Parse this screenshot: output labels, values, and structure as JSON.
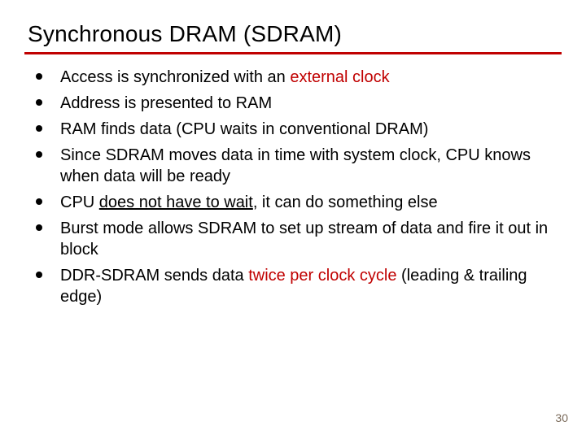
{
  "title": "Synchronous DRAM (SDRAM)",
  "bullets": [
    {
      "pre": "Access is synchronized with an ",
      "hl": "external clock",
      "post": ""
    },
    {
      "pre": "Address is presented to RAM",
      "hl": "",
      "post": ""
    },
    {
      "pre": "RAM finds data (CPU waits in conventional DRAM)",
      "hl": "",
      "post": ""
    },
    {
      "pre": "Since SDRAM moves data in time with system clock, CPU knows when data will be ready",
      "hl": "",
      "post": ""
    },
    {
      "pre": "CPU ",
      "ul": "does not have to wait",
      "post": ", it can do something else"
    },
    {
      "pre": "Burst mode allows SDRAM to set up stream of data and fire it out in block",
      "hl": "",
      "post": ""
    },
    {
      "pre": "DDR-SDRAM sends data ",
      "hl": "twice per clock cycle",
      "post": " (leading & trailing edge)"
    }
  ],
  "page_number": "30"
}
